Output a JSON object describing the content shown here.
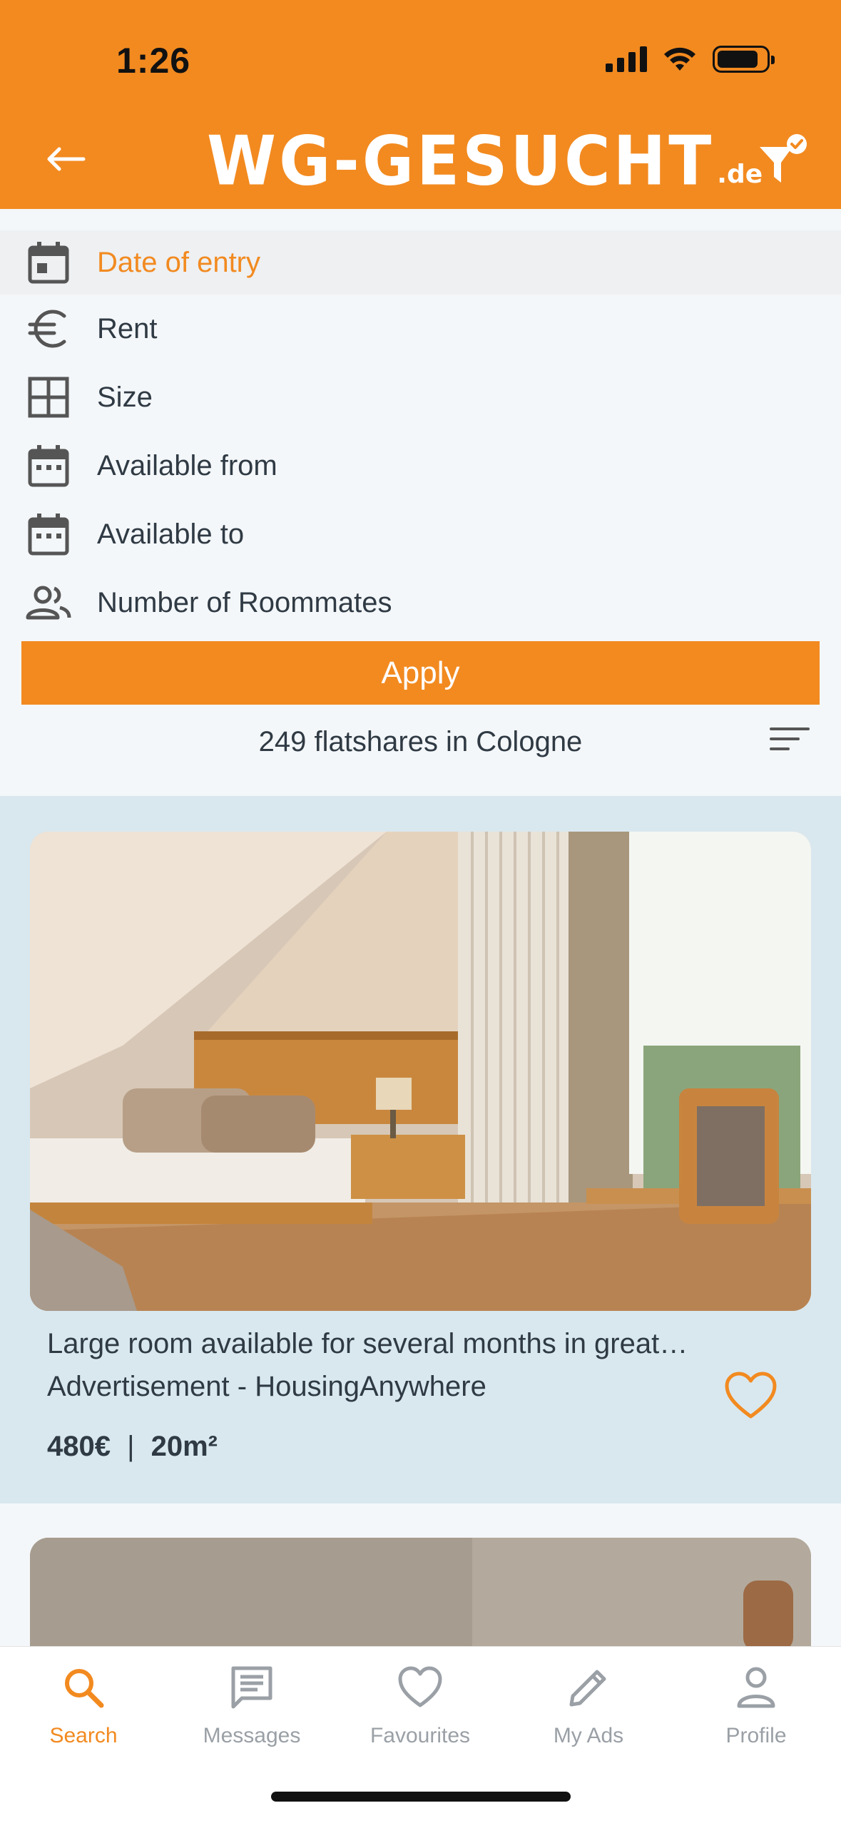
{
  "status": {
    "time": "1:26"
  },
  "header": {
    "logo_main": "WG-GESUCHT",
    "logo_sub": ".de",
    "back_icon": "arrow-left-icon",
    "filter_icon": "filter-check-icon"
  },
  "filters": {
    "items": [
      {
        "label": "Date of entry",
        "icon": "calendar-icon"
      },
      {
        "label": "Rent",
        "icon": "euro-icon"
      },
      {
        "label": "Size",
        "icon": "grid-icon"
      },
      {
        "label": "Available from",
        "icon": "calendar-icon"
      },
      {
        "label": "Available to",
        "icon": "calendar-icon"
      },
      {
        "label": "Number of Roommates",
        "icon": "people-icon"
      }
    ],
    "active_index": 0,
    "apply_label": "Apply"
  },
  "results": {
    "count_text": "249 flatshares in Cologne",
    "sort_icon": "sort-icon"
  },
  "listing": {
    "title": "Large room available for several months in great…",
    "subtitle": "Advertisement - HousingAnywhere",
    "price": "480€",
    "separator": "|",
    "size": "20m²"
  },
  "tabbar": {
    "items": [
      {
        "label": "Search",
        "icon": "search-icon"
      },
      {
        "label": "Messages",
        "icon": "message-icon"
      },
      {
        "label": "Favourites",
        "icon": "heart-icon"
      },
      {
        "label": "My Ads",
        "icon": "pencil-icon"
      },
      {
        "label": "Profile",
        "icon": "person-icon"
      }
    ],
    "active_index": 0
  },
  "colors": {
    "brand": "#f28a20",
    "text": "#2f3a44",
    "listing_bg": "#d9e8ef",
    "inactive_tab": "#9aa0a6"
  }
}
